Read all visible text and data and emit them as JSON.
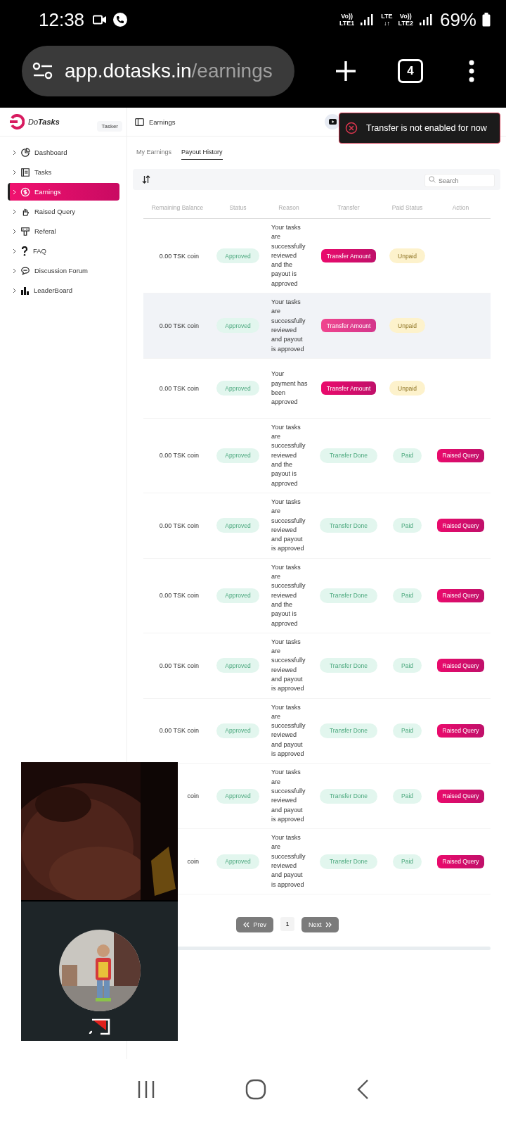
{
  "status_bar": {
    "time": "12:38",
    "network": [
      {
        "top": "Vo))",
        "bottom": "LTE1"
      },
      {
        "top": "LTE",
        "bottom": "↓↑"
      },
      {
        "top": "Vo))",
        "bottom": "LTE2"
      }
    ],
    "battery": "69%"
  },
  "browser": {
    "url_host": "app.dotasks.in",
    "url_path": "/earnings",
    "tab_count": "4"
  },
  "sidebar": {
    "logo": "Do**Tasks**",
    "role": "Tasker",
    "items": [
      {
        "label": "Dashboard",
        "selected": false
      },
      {
        "label": "Tasks",
        "selected": false
      },
      {
        "label": "Earnings",
        "selected": true
      },
      {
        "label": "Raised Query",
        "selected": false
      },
      {
        "label": "Referal",
        "selected": false
      },
      {
        "label": "FAQ",
        "selected": false
      },
      {
        "label": "Discussion Forum",
        "selected": false
      },
      {
        "label": "LeaderBoard",
        "selected": false
      }
    ]
  },
  "header": {
    "title": "Earnings"
  },
  "toast": {
    "message": "Transfer is not enabled for now"
  },
  "tabs": [
    {
      "label": "My Earnings",
      "selected": false
    },
    {
      "label": "Payout History",
      "selected": true
    }
  ],
  "search": {
    "placeholder": "Search"
  },
  "table": {
    "columns": [
      "Remaining Balance",
      "Status",
      "Reason",
      "Transfer",
      "Paid Status",
      "Action"
    ],
    "rows": [
      {
        "balance": "0.00 TSK coin",
        "hovered": false,
        "status": {
          "label": "Approved",
          "kind": "approved"
        },
        "reason": "Your tasks are successfully reviewed and the payout is approved",
        "transfer": {
          "label": "Transfer Amount",
          "kind": "amount"
        },
        "paid_status": {
          "label": "Unpaid",
          "kind": "unpaid"
        }
      },
      {
        "balance": "0.00 TSK coin",
        "hovered": true,
        "status": {
          "label": "Approved",
          "kind": "approved"
        },
        "reason": "Your tasks are successfully reviewed and payout is approved",
        "transfer": {
          "label": "Transfer Amount",
          "kind": "amount"
        },
        "paid_status": {
          "label": "Unpaid",
          "kind": "unpaid"
        }
      },
      {
        "balance": "0.00 TSK coin",
        "hovered": false,
        "status": {
          "label": "Approved",
          "kind": "approved"
        },
        "reason": "Your payment has been approved",
        "transfer": {
          "label": "Transfer Amount",
          "kind": "amount"
        },
        "paid_status": {
          "label": "Unpaid",
          "kind": "unpaid"
        }
      },
      {
        "balance": "0.00 TSK coin",
        "hovered": false,
        "status": {
          "label": "Approved",
          "kind": "approved"
        },
        "reason": "Your tasks are successfully reviewed and the payout is approved",
        "transfer": {
          "label": "Transfer Done",
          "kind": "done"
        },
        "paid_status": {
          "label": "Paid",
          "kind": "paid"
        },
        "action": "Raised Query"
      },
      {
        "balance": "0.00 TSK coin",
        "hovered": false,
        "status": {
          "label": "Approved",
          "kind": "approved"
        },
        "reason": "Your tasks are successfully reviewed and payout is approved",
        "transfer": {
          "label": "Transfer Done",
          "kind": "done"
        },
        "paid_status": {
          "label": "Paid",
          "kind": "paid"
        },
        "action": "Raised Query"
      },
      {
        "balance": "0.00 TSK coin",
        "hovered": false,
        "status": {
          "label": "Approved",
          "kind": "approved"
        },
        "reason": "Your tasks are successfully reviewed and the payout is approved",
        "transfer": {
          "label": "Transfer Done",
          "kind": "done"
        },
        "paid_status": {
          "label": "Paid",
          "kind": "paid"
        },
        "action": "Raised Query"
      },
      {
        "balance": "0.00 TSK coin",
        "hovered": false,
        "status": {
          "label": "Approved",
          "kind": "approved"
        },
        "reason": "Your tasks are successfully reviewed and payout is approved",
        "transfer": {
          "label": "Transfer Done",
          "kind": "done"
        },
        "paid_status": {
          "label": "Paid",
          "kind": "paid"
        },
        "action": "Raised Query"
      },
      {
        "balance": "0.00 TSK coin",
        "hovered": false,
        "status": {
          "label": "Approved",
          "kind": "approved"
        },
        "reason": "Your tasks are successfully reviewed and payout is approved",
        "transfer": {
          "label": "Transfer Done",
          "kind": "done"
        },
        "paid_status": {
          "label": "Paid",
          "kind": "paid"
        },
        "action": "Raised Query"
      },
      {
        "balance": "coin",
        "hovered": false,
        "status": {
          "label": "Approved",
          "kind": "approved"
        },
        "reason": "Your tasks are successfully reviewed and payout is approved",
        "transfer": {
          "label": "Transfer Done",
          "kind": "done"
        },
        "paid_status": {
          "label": "Paid",
          "kind": "paid"
        },
        "action": "Raised Query"
      },
      {
        "balance": "coin",
        "hovered": false,
        "status": {
          "label": "Approved",
          "kind": "approved"
        },
        "reason": "Your tasks are successfully reviewed and payout is approved",
        "transfer": {
          "label": "Transfer Done",
          "kind": "done"
        },
        "paid_status": {
          "label": "Paid",
          "kind": "paid"
        },
        "action": "Raised Query"
      }
    ]
  },
  "pagination": {
    "prev": "Prev",
    "page": "1",
    "next": "Next"
  }
}
